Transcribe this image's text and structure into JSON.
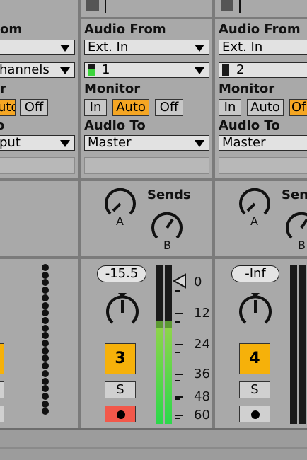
{
  "labels": {
    "audio_from": "Audio From",
    "monitor": "Monitor",
    "audio_to": "Audio To",
    "sends": "Sends"
  },
  "left_partial": {
    "audio_from_label": "om",
    "input_channel": "hannels",
    "monitor_label": "r",
    "monitor_auto": "uto",
    "monitor_off": "Off",
    "audio_to_label": "o",
    "audio_to_value": "put"
  },
  "track3": {
    "audio_from_value": "Ext. In",
    "input_channel_value": "1",
    "monitor_in": "In",
    "monitor_auto": "Auto",
    "monitor_off": "Off",
    "monitor_active": "Auto",
    "audio_to_value": "Master",
    "send_a": "A",
    "send_b": "B",
    "volume": "-15.5",
    "track_number": "3",
    "solo": "S",
    "armed": true,
    "meter_level": 0.6
  },
  "track4": {
    "audio_from_value": "Ext. In",
    "input_channel_value": "2",
    "monitor_in": "In",
    "monitor_auto": "Auto",
    "monitor_off": "Of",
    "monitor_active": "Off",
    "audio_to_value": "Master",
    "send_a": "A",
    "send_b": "B",
    "sends_label": "Sen",
    "volume": "-Inf",
    "track_number": "4",
    "solo": "S",
    "armed": false,
    "meter_level": 0
  },
  "meter_scale": [
    "0",
    "12",
    "24",
    "36",
    "48",
    "60"
  ],
  "colors": {
    "accent_orange": "#f6b10a",
    "monitor_active": "#f5a623",
    "arm_red": "#f2584a",
    "meter_green": "#2bd84a"
  }
}
